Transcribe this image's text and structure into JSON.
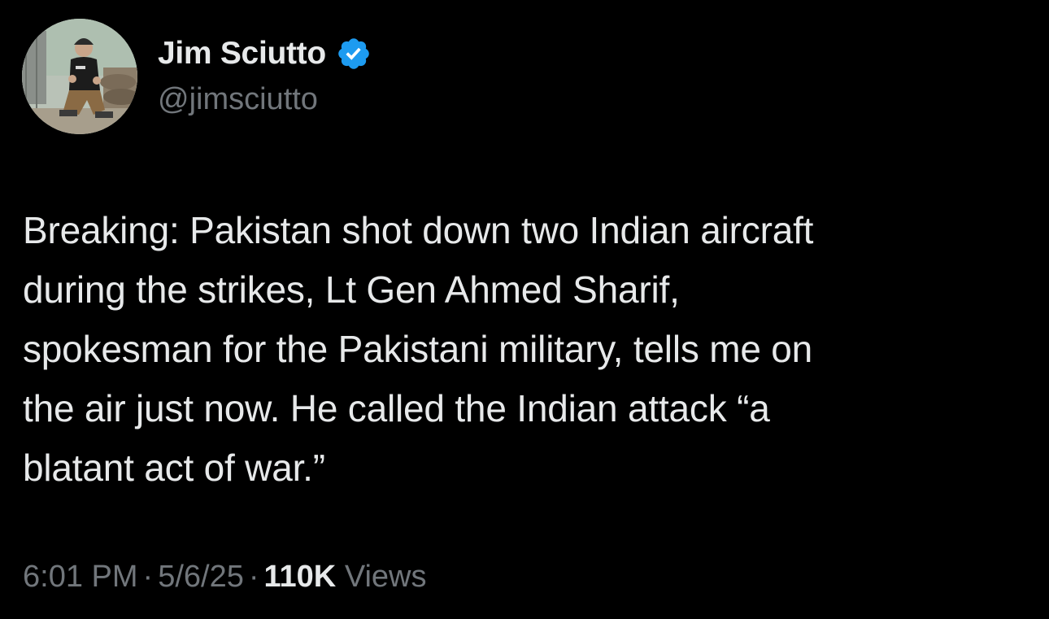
{
  "author": {
    "display_name": "Jim Sciutto",
    "handle": "@jimsciutto",
    "verified": true,
    "verified_color": "#1d9bf0",
    "avatar_icon": "profile-photo"
  },
  "tweet": {
    "text": "Breaking: Pakistan shot down two Indian aircraft\nduring the strikes, Lt Gen Ahmed Sharif,\nspokesman for the Pakistani military, tells me on\nthe air just now. He called the Indian attack “a\nblatant act of war.”"
  },
  "meta": {
    "time": "6:01 PM",
    "separator": "·",
    "date": "5/6/25",
    "views_count": "110K",
    "views_label": "Views"
  },
  "colors": {
    "background": "#000000",
    "primary_text": "#e7e9ea",
    "secondary_text": "#71767b"
  }
}
